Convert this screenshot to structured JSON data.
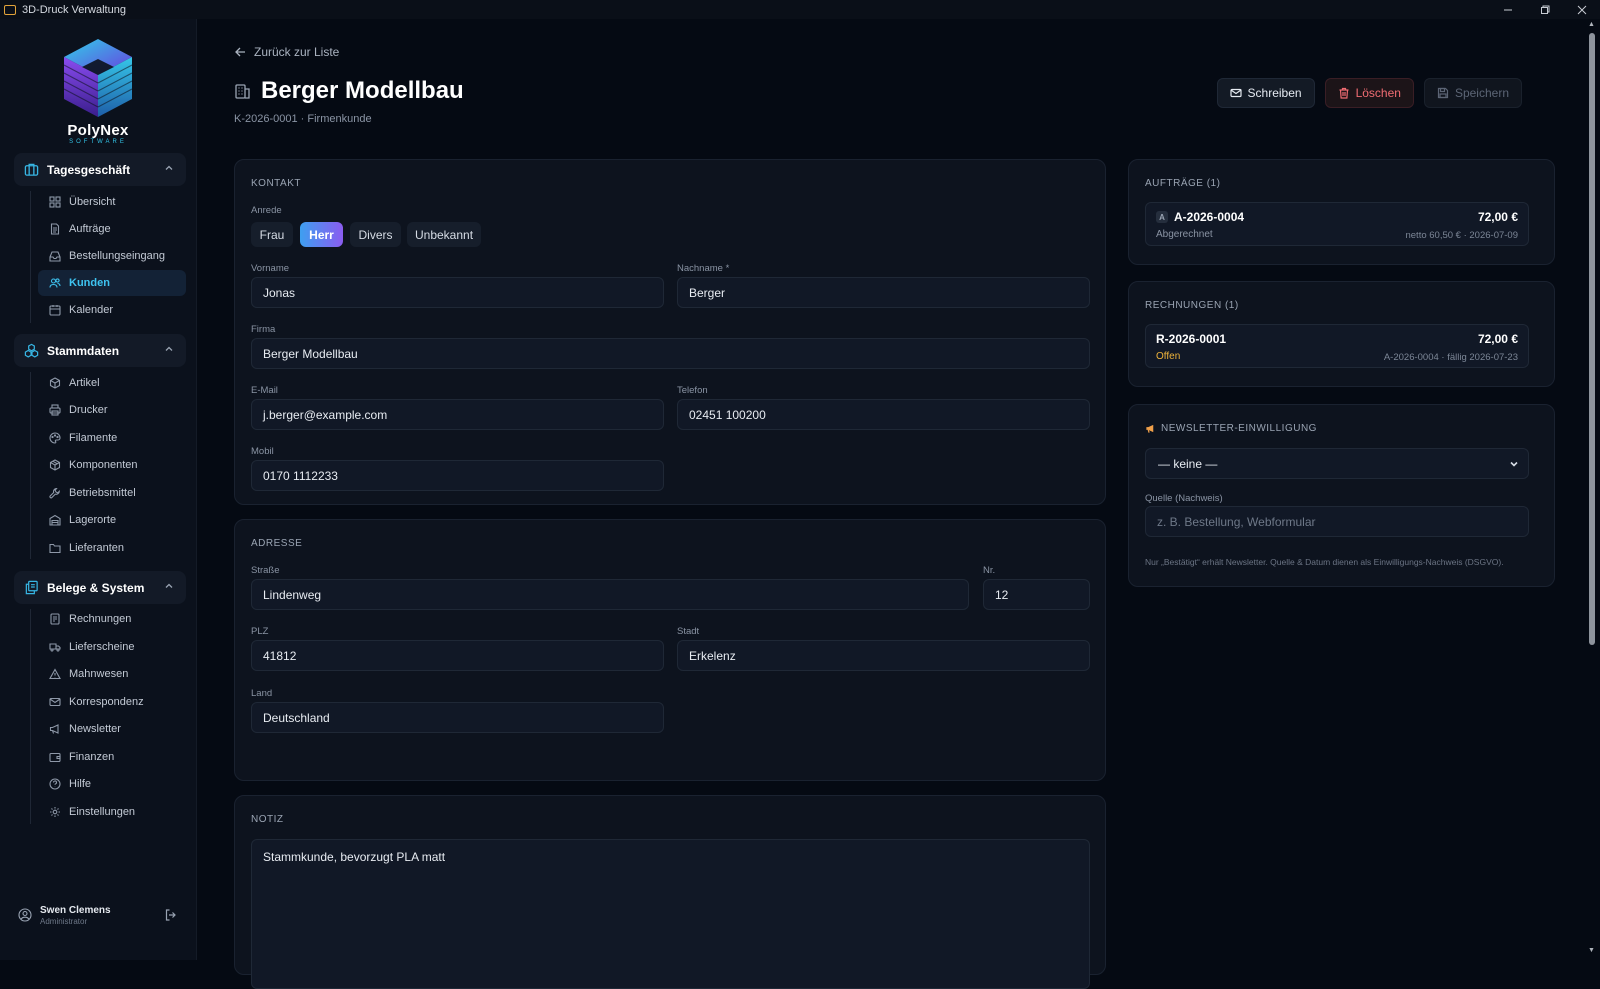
{
  "window": {
    "title": "3D-Druck Verwaltung"
  },
  "brand": {
    "name": "PolyNex",
    "sub": "SOFTWARE"
  },
  "nav": {
    "groups": [
      {
        "label": "Tagesgeschäft",
        "items": [
          "Übersicht",
          "Aufträge",
          "Bestellungseingang",
          "Kunden",
          "Kalender"
        ]
      },
      {
        "label": "Stammdaten",
        "items": [
          "Artikel",
          "Drucker",
          "Filamente",
          "Komponenten",
          "Betriebsmittel",
          "Lagerorte",
          "Lieferanten"
        ]
      },
      {
        "label": "Belege & System",
        "items": [
          "Rechnungen",
          "Lieferscheine",
          "Mahnwesen",
          "Korrespondenz",
          "Newsletter",
          "Finanzen",
          "Hilfe",
          "Einstellungen"
        ]
      }
    ],
    "active": "Kunden"
  },
  "user": {
    "name": "Swen Clemens",
    "role": "Administrator"
  },
  "header": {
    "back": "Zurück zur Liste",
    "title": "Berger Modellbau",
    "subtitle": "K-2026-0001 · Firmenkunde",
    "btn_write": "Schreiben",
    "btn_delete": "Löschen",
    "btn_save": "Speichern"
  },
  "contact": {
    "section": "Kontakt",
    "salutation_label": "Anrede",
    "salutations": [
      "Frau",
      "Herr",
      "Divers",
      "Unbekannt"
    ],
    "salutation_selected": "Herr",
    "firstname_label": "Vorname",
    "firstname": "Jonas",
    "lastname_label": "Nachname *",
    "lastname": "Berger",
    "company_label": "Firma",
    "company": "Berger Modellbau",
    "email_label": "E-Mail",
    "email": "j.berger@example.com",
    "phone_label": "Telefon",
    "phone": "02451 100200",
    "mobile_label": "Mobil",
    "mobile": "0170 1112233"
  },
  "address": {
    "section": "Adresse",
    "street_label": "Straße",
    "street": "Lindenweg",
    "nr_label": "Nr.",
    "nr": "12",
    "zip_label": "PLZ",
    "zip": "41812",
    "city_label": "Stadt",
    "city": "Erkelenz",
    "country_label": "Land",
    "country": "Deutschland"
  },
  "note": {
    "section": "Notiz",
    "text": "Stammkunde, bevorzugt PLA matt"
  },
  "orders": {
    "title": "Aufträge (1)",
    "items": [
      {
        "badge": "A",
        "code": "A-2026-0004",
        "amount": "72,00 €",
        "status": "Abgerechnet",
        "meta": "netto 60,50 € · 2026-07-09"
      }
    ]
  },
  "invoices": {
    "title": "Rechnungen (1)",
    "items": [
      {
        "code": "R-2026-0001",
        "amount": "72,00 €",
        "status": "Offen",
        "meta": "A-2026-0004 · fällig 2026-07-23"
      }
    ]
  },
  "newsletter": {
    "title": "Newsletter-Einwilligung",
    "selected": "— keine —",
    "source_label": "Quelle (Nachweis)",
    "source_placeholder": "z. B. Bestellung, Webformular",
    "hint": "Nur „Bestätigt“ erhält Newsletter. Quelle & Datum dienen als Einwilligungs-Nachweis (DSGVO)."
  },
  "colors": {
    "accent": "#3ec3f0",
    "danger": "#ef6c72",
    "warning": "#f0b43a",
    "bg": "#050a13"
  }
}
